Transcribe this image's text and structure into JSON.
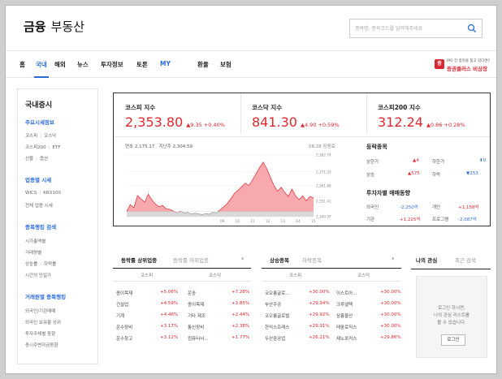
{
  "header": {
    "brand": "금융",
    "section": "부동산",
    "search_placeholder": "종목명, 종목코드를 입력해주세요"
  },
  "nav": [
    {
      "label": "홈",
      "state": "normal"
    },
    {
      "label": "국내",
      "state": "active"
    },
    {
      "label": "해외",
      "state": "normal"
    },
    {
      "label": "뉴스",
      "state": "normal"
    },
    {
      "label": "투자정보",
      "state": "normal"
    },
    {
      "label": "토론",
      "state": "normal"
    },
    {
      "label": "MY",
      "state": "blue"
    },
    {
      "label": "환율",
      "state": "normal"
    },
    {
      "label": "보험",
      "state": "normal"
    }
  ],
  "promo": {
    "logo": "증",
    "line1": "IPO 전 종목을 찾고 있다면?",
    "line2": "증권플러스 비상장"
  },
  "sidebar": {
    "title": "국내증시",
    "sections": [
      {
        "label": "주요시세정보",
        "links": [
          "코스피",
          "코스닥",
          "코스피200",
          "ETF",
          "선물",
          "옵션"
        ]
      },
      {
        "label": "업종별 시세",
        "links": [
          "WICS",
          "KRX100",
          "전체 업종 시세"
        ]
      },
      {
        "label": "종목랭킹 검색",
        "links": [
          "시가총액별",
          "거래량별",
          "상승률",
          "하락률",
          "시간외 단일가"
        ]
      },
      {
        "label": "거래원별 종목랭킹",
        "links": [
          "외국인/기관매매",
          "외국인 보유율 상위",
          "투자주체별 동향",
          "증시주변자금동향"
        ]
      }
    ]
  },
  "indices": [
    {
      "name": "코스피 지수",
      "value": "2,353.80",
      "change": "▲9.35 +0.40%"
    },
    {
      "name": "코스닥 지수",
      "value": "841.30",
      "change": "▲4.90 +0.59%"
    },
    {
      "name": "코스피200 지수",
      "value": "312.24",
      "change": "▲0.86 +0.28%"
    }
  ],
  "chart_info": {
    "year_high_label": "연초",
    "year_high": "2,175.17",
    "prev_label": "지난주",
    "prev": "2,304.59",
    "date": "08.28 장종료"
  },
  "chart_data": {
    "type": "area",
    "x_ticks": [
      "09",
      "10",
      "11",
      "12",
      "13",
      "14",
      "15"
    ],
    "y_ticks": [
      "2,382.74",
      "2,371.33",
      "2,361.86",
      "2,351.41",
      "2,340.97"
    ],
    "ylim": [
      2340.97,
      2382.74
    ],
    "prev_close": 2344.45,
    "colors": {
      "below": "#d9d9d9",
      "above": "#f7a9ad",
      "line_above": "#e0282f",
      "line_below": "#999999"
    },
    "values": [
      2344.5,
      2349.2,
      2347.1,
      2355.3,
      2353.0,
      2350.8,
      2356.2,
      2352.4,
      2349.6,
      2347.7,
      2348.6,
      2346.3,
      2345.9,
      2344.8,
      2343.6,
      2344.7,
      2343.4,
      2344.0,
      2342.7,
      2343.3,
      2342.9,
      2342.4,
      2343.1,
      2342.6,
      2344.0,
      2343.5,
      2345.6,
      2347.7,
      2349.9,
      2353.2,
      2356.8,
      2358.9,
      2361.3,
      2363.7,
      2362.1,
      2365.8,
      2370.1,
      2374.3,
      2377.9,
      2373.4,
      2367.6,
      2362.0,
      2358.2,
      2360.9,
      2357.3,
      2354.8,
      2359.7,
      2355.0,
      2352.6,
      2355.1,
      2351.8,
      2354.6,
      2353.8
    ]
  },
  "updown": {
    "title": "등락종목",
    "items": [
      {
        "k": "상한가",
        "v": "▲4",
        "c": "red"
      },
      {
        "k": "하한가",
        "v": "⬇0",
        "c": "blue"
      },
      {
        "k": "상승",
        "v": "▲575",
        "c": "red"
      },
      {
        "k": "하락",
        "v": "▼253",
        "c": "blue"
      }
    ]
  },
  "investors": {
    "title": "투자자별 매매동향",
    "items": [
      {
        "k": "외국인",
        "v": "-2,250억",
        "c": "blue"
      },
      {
        "k": "개인",
        "v": "+1,158억",
        "c": "red"
      },
      {
        "k": "기관",
        "v": "+1,225억",
        "c": "red"
      },
      {
        "k": "프로그램",
        "v": "-2,087억",
        "c": "blue"
      }
    ]
  },
  "sector_panel": {
    "tab_on": "등락률 상위업종",
    "tab_off": "등락률 하위업종",
    "arrow": "›",
    "cols": [
      "코스피",
      "코스닥"
    ],
    "left": [
      [
        "종이목재",
        "+5.06%"
      ],
      [
        "건설업",
        "+4.59%"
      ],
      [
        "기계",
        "+4.46%"
      ],
      [
        "운수장비",
        "+3.17%"
      ],
      [
        "운수창고",
        "+3.12%"
      ]
    ],
    "right": [
      [
        "운송",
        "+7.28%"
      ],
      [
        "종이목재",
        "+3.85%"
      ],
      [
        "기타 제조",
        "+2.44%"
      ],
      [
        "통신장비",
        "+2.38%"
      ],
      [
        "컴퓨터서...",
        "+1.77%"
      ]
    ]
  },
  "stock_panel": {
    "tab_on": "상승종목",
    "tab_off": "하락종목",
    "arrow": "›",
    "cols": [
      "코스피",
      "코스닥"
    ],
    "left": [
      [
        "코오롱글로...",
        "+30.00%"
      ],
      [
        "부산주공",
        "+29.94%"
      ],
      [
        "코오롱글로벌",
        "+29.92%"
      ],
      [
        "한익스프레스",
        "+29.91%"
      ],
      [
        "두산중공업",
        "+26.21%"
      ]
    ],
    "right": [
      [
        "이스트아...",
        "+30.00%"
      ],
      [
        "크루셜텍",
        "+30.00%"
      ],
      [
        "삼륭물산",
        "+30.00%"
      ],
      [
        "태웅로직스",
        "+30.00%"
      ],
      [
        "제노포커스",
        "+29.86%"
      ]
    ]
  },
  "my_panel": {
    "tab_on": "나의 관심",
    "tab_off": "최근 검색",
    "msg": [
      "로그인 하시면,",
      "나의 관심 리스트를",
      "볼 수 있습니다."
    ],
    "button": "로그인"
  }
}
